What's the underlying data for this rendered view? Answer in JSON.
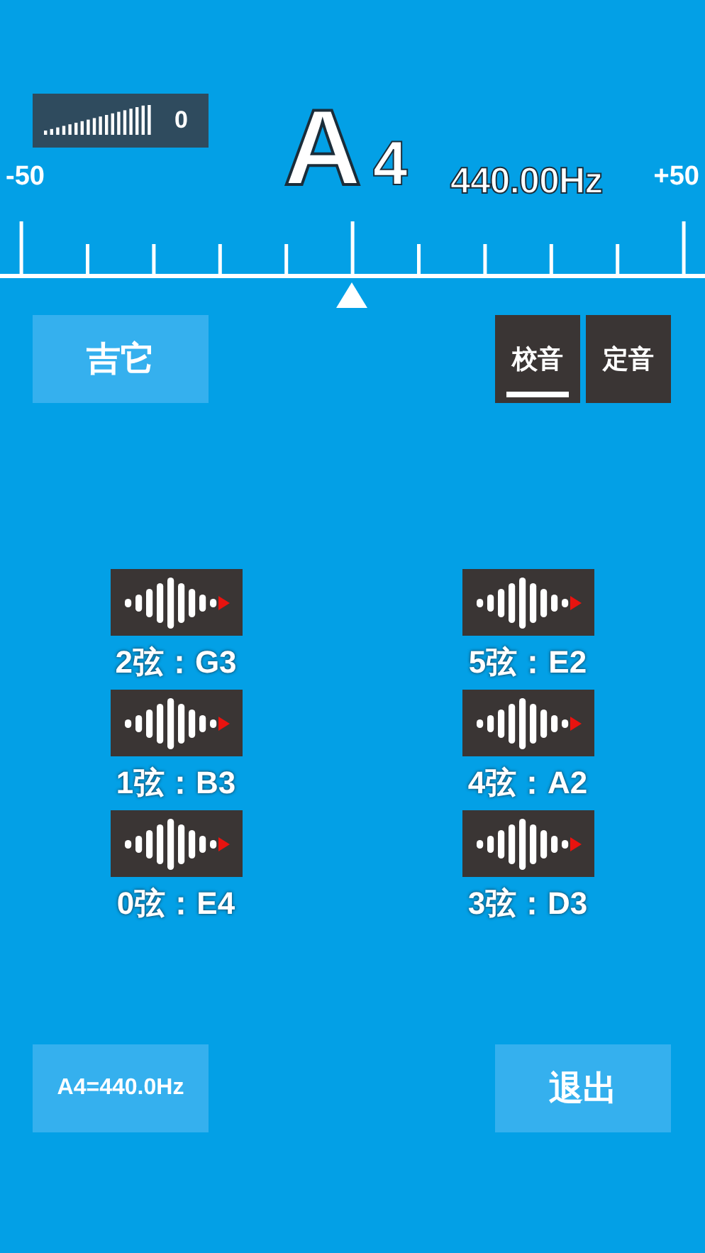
{
  "meter": {
    "reading": "0"
  },
  "note": {
    "letter": "A",
    "octave": "4",
    "frequency": "440.00Hz"
  },
  "scale": {
    "min_label": "-50",
    "max_label": "+50"
  },
  "instrument_button": "吉它",
  "tabs": [
    {
      "label": "校音",
      "selected": true
    },
    {
      "label": "定音",
      "selected": false
    }
  ],
  "strings": [
    {
      "label": "2弦：G3"
    },
    {
      "label": "5弦：E2"
    },
    {
      "label": "1弦：B3"
    },
    {
      "label": "4弦：A2"
    },
    {
      "label": "0弦：E4"
    },
    {
      "label": "3弦：D3"
    }
  ],
  "reference_button": "A4=440.0Hz",
  "exit_button": "退出"
}
